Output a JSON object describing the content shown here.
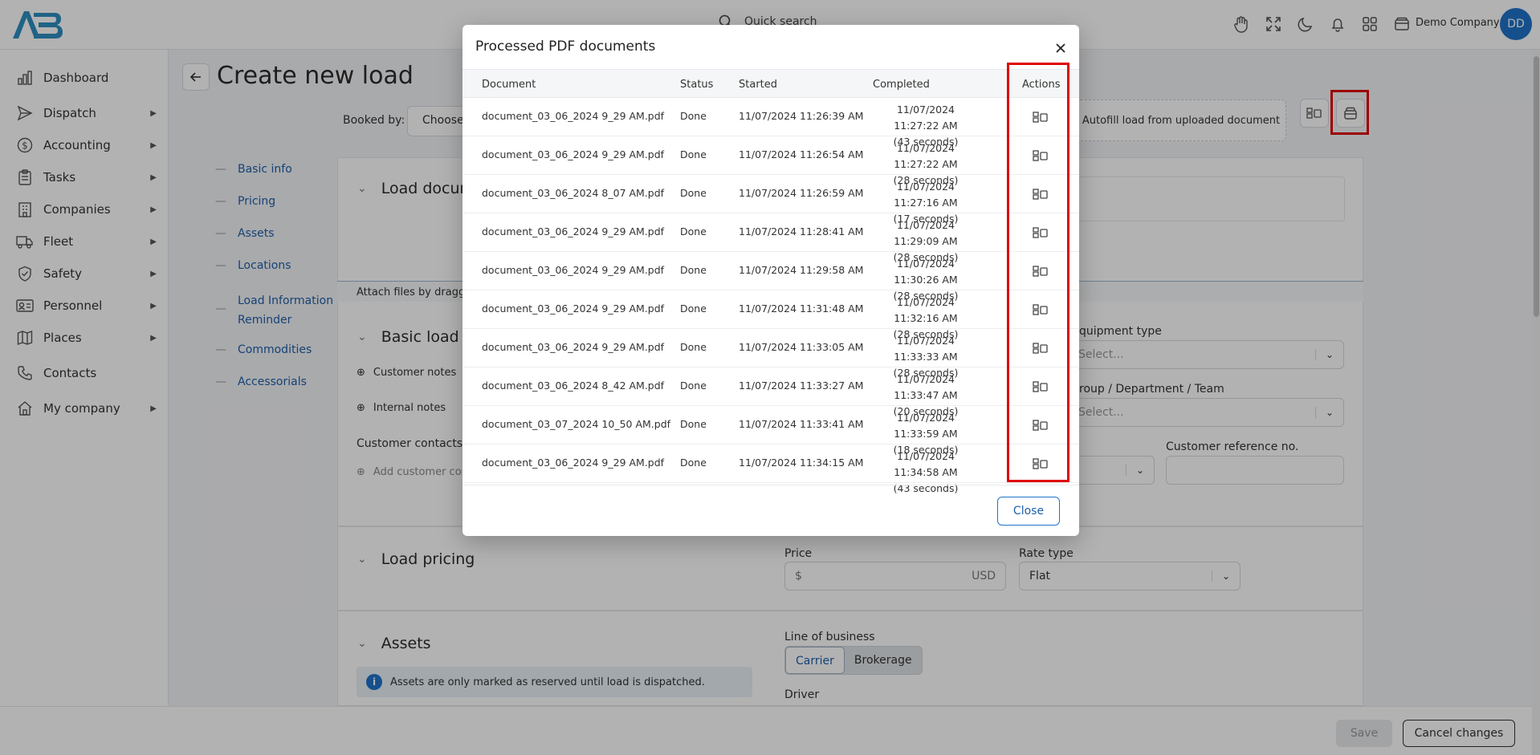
{
  "app": {
    "logo_text": "AB",
    "quick_search": "Quick search",
    "company_name": "Demo Company",
    "avatar_initials": "DD"
  },
  "sidebar": {
    "items": [
      {
        "label": "Dashboard",
        "icon": "chart-icon",
        "expandable": false
      },
      {
        "label": "Dispatch",
        "icon": "send-icon",
        "expandable": true
      },
      {
        "label": "Accounting",
        "icon": "dollar-icon",
        "expandable": true
      },
      {
        "label": "Tasks",
        "icon": "clipboard-icon",
        "expandable": true
      },
      {
        "label": "Companies",
        "icon": "building-icon",
        "expandable": true
      },
      {
        "label": "Fleet",
        "icon": "truck-icon",
        "expandable": true
      },
      {
        "label": "Safety",
        "icon": "shield-icon",
        "expandable": true
      },
      {
        "label": "Personnel",
        "icon": "id-card-icon",
        "expandable": true
      },
      {
        "label": "Places",
        "icon": "map-icon",
        "expandable": true
      },
      {
        "label": "Contacts",
        "icon": "phone-icon",
        "expandable": false
      },
      {
        "label": "My company",
        "icon": "home-icon",
        "expandable": true
      }
    ]
  },
  "page": {
    "title": "Create new load",
    "booked_by_label": "Booked by:",
    "booked_by_value": "Choose",
    "autofill_label": "Autofill load from uploaded document",
    "toc": [
      "Basic info",
      "Pricing",
      "Assets",
      "Locations",
      "Load Information Reminder",
      "Commodities",
      "Accessorials"
    ],
    "load_documents_title": "Load docum",
    "attach_text": "Attach files by dragging",
    "basic_load_title": "Basic load in",
    "customer_notes": "Customer notes",
    "internal_notes": "Internal notes",
    "customer_contacts": "Customer contacts",
    "add_customer_contact": "Add customer con",
    "equipment_type_label": "quipment type",
    "equipment_type_placeholder": "Select...",
    "group_label": "roup / Department / Team",
    "group_placeholder": "Select...",
    "customer_ref_label": "Customer reference no.",
    "load_pricing_title": "Load pricing",
    "price_label": "Price",
    "price_prefix": "$",
    "price_currency": "USD",
    "rate_type_label": "Rate type",
    "rate_type_value": "Flat",
    "assets_title": "Assets",
    "assets_info": "Assets are only marked as reserved until load is dispatched.",
    "line_of_business_label": "Line of business",
    "lob_options": [
      "Carrier",
      "Brokerage"
    ],
    "lob_selected": "Carrier",
    "driver_label": "Driver",
    "save_label": "Save",
    "cancel_label": "Cancel changes"
  },
  "modal": {
    "title": "Processed PDF documents",
    "columns": [
      "Document",
      "Status",
      "Started",
      "Completed",
      "Actions"
    ],
    "rows": [
      {
        "document": "document_03_06_2024 9_29 AM.pdf",
        "status": "Done",
        "started": "11/07/2024 11:26:39 AM",
        "completed": "11/07/2024 11:27:22 AM",
        "duration": "(43 seconds)"
      },
      {
        "document": "document_03_06_2024 9_29 AM.pdf",
        "status": "Done",
        "started": "11/07/2024 11:26:54 AM",
        "completed": "11/07/2024 11:27:22 AM",
        "duration": "(28 seconds)"
      },
      {
        "document": "document_03_06_2024 8_07 AM.pdf",
        "status": "Done",
        "started": "11/07/2024 11:26:59 AM",
        "completed": "11/07/2024 11:27:16 AM",
        "duration": "(17 seconds)"
      },
      {
        "document": "document_03_06_2024 9_29 AM.pdf",
        "status": "Done",
        "started": "11/07/2024 11:28:41 AM",
        "completed": "11/07/2024 11:29:09 AM",
        "duration": "(28 seconds)"
      },
      {
        "document": "document_03_06_2024 9_29 AM.pdf",
        "status": "Done",
        "started": "11/07/2024 11:29:58 AM",
        "completed": "11/07/2024 11:30:26 AM",
        "duration": "(28 seconds)"
      },
      {
        "document": "document_03_06_2024 9_29 AM.pdf",
        "status": "Done",
        "started": "11/07/2024 11:31:48 AM",
        "completed": "11/07/2024 11:32:16 AM",
        "duration": "(28 seconds)"
      },
      {
        "document": "document_03_06_2024 9_29 AM.pdf",
        "status": "Done",
        "started": "11/07/2024 11:33:05 AM",
        "completed": "11/07/2024 11:33:33 AM",
        "duration": "(28 seconds)"
      },
      {
        "document": "document_03_06_2024 8_42 AM.pdf",
        "status": "Done",
        "started": "11/07/2024 11:33:27 AM",
        "completed": "11/07/2024 11:33:47 AM",
        "duration": "(20 seconds)"
      },
      {
        "document": "document_03_07_2024 10_50 AM.pdf",
        "status": "Done",
        "started": "11/07/2024 11:33:41 AM",
        "completed": "11/07/2024 11:33:59 AM",
        "duration": "(18 seconds)"
      },
      {
        "document": "document_03_06_2024 9_29 AM.pdf",
        "status": "Done",
        "started": "11/07/2024 11:34:15 AM",
        "completed": "11/07/2024 11:34:58 AM",
        "duration": "(43 seconds)"
      }
    ],
    "action_icon": "view-document-icon",
    "close_label": "Close"
  },
  "colors": {
    "accent": "#1f73c9",
    "link": "#1f5fa8",
    "highlight": "#e00000"
  }
}
